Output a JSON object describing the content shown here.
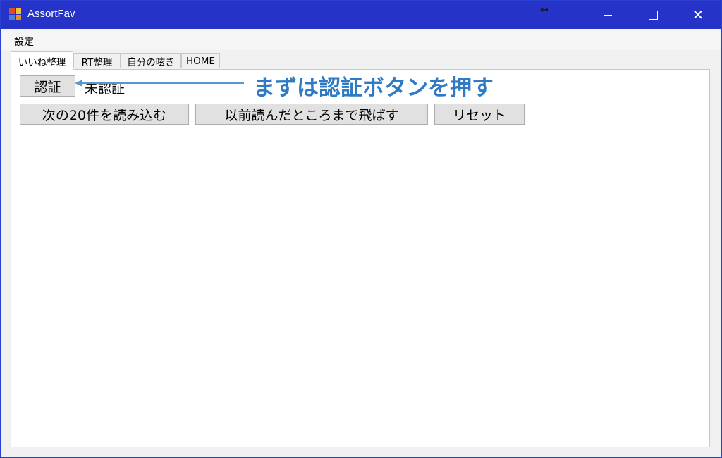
{
  "window": {
    "title": "AssortFav",
    "controls": {
      "minimize": "minimize",
      "maximize": "maximize",
      "close": "close"
    },
    "accent_color": "#2633c9"
  },
  "menubar": {
    "items": [
      {
        "label": "設定"
      }
    ]
  },
  "tabs": [
    {
      "label": "いいね整理",
      "selected": true
    },
    {
      "label": "RT整理",
      "selected": false
    },
    {
      "label": "自分の呟き",
      "selected": false
    },
    {
      "label": "HOME",
      "selected": false
    }
  ],
  "panel": {
    "auth_button": "認証",
    "auth_status": "未認証",
    "load_next_button": "次の20件を読み込む",
    "skip_button": "以前読んだところまで飛ばす",
    "reset_button": "リセット"
  },
  "annotation": {
    "text": "まずは認証ボタンを押す",
    "color": "#2e7ac4"
  },
  "icons": {
    "app": "app-icon",
    "resize": "resize-cursor-icon"
  }
}
